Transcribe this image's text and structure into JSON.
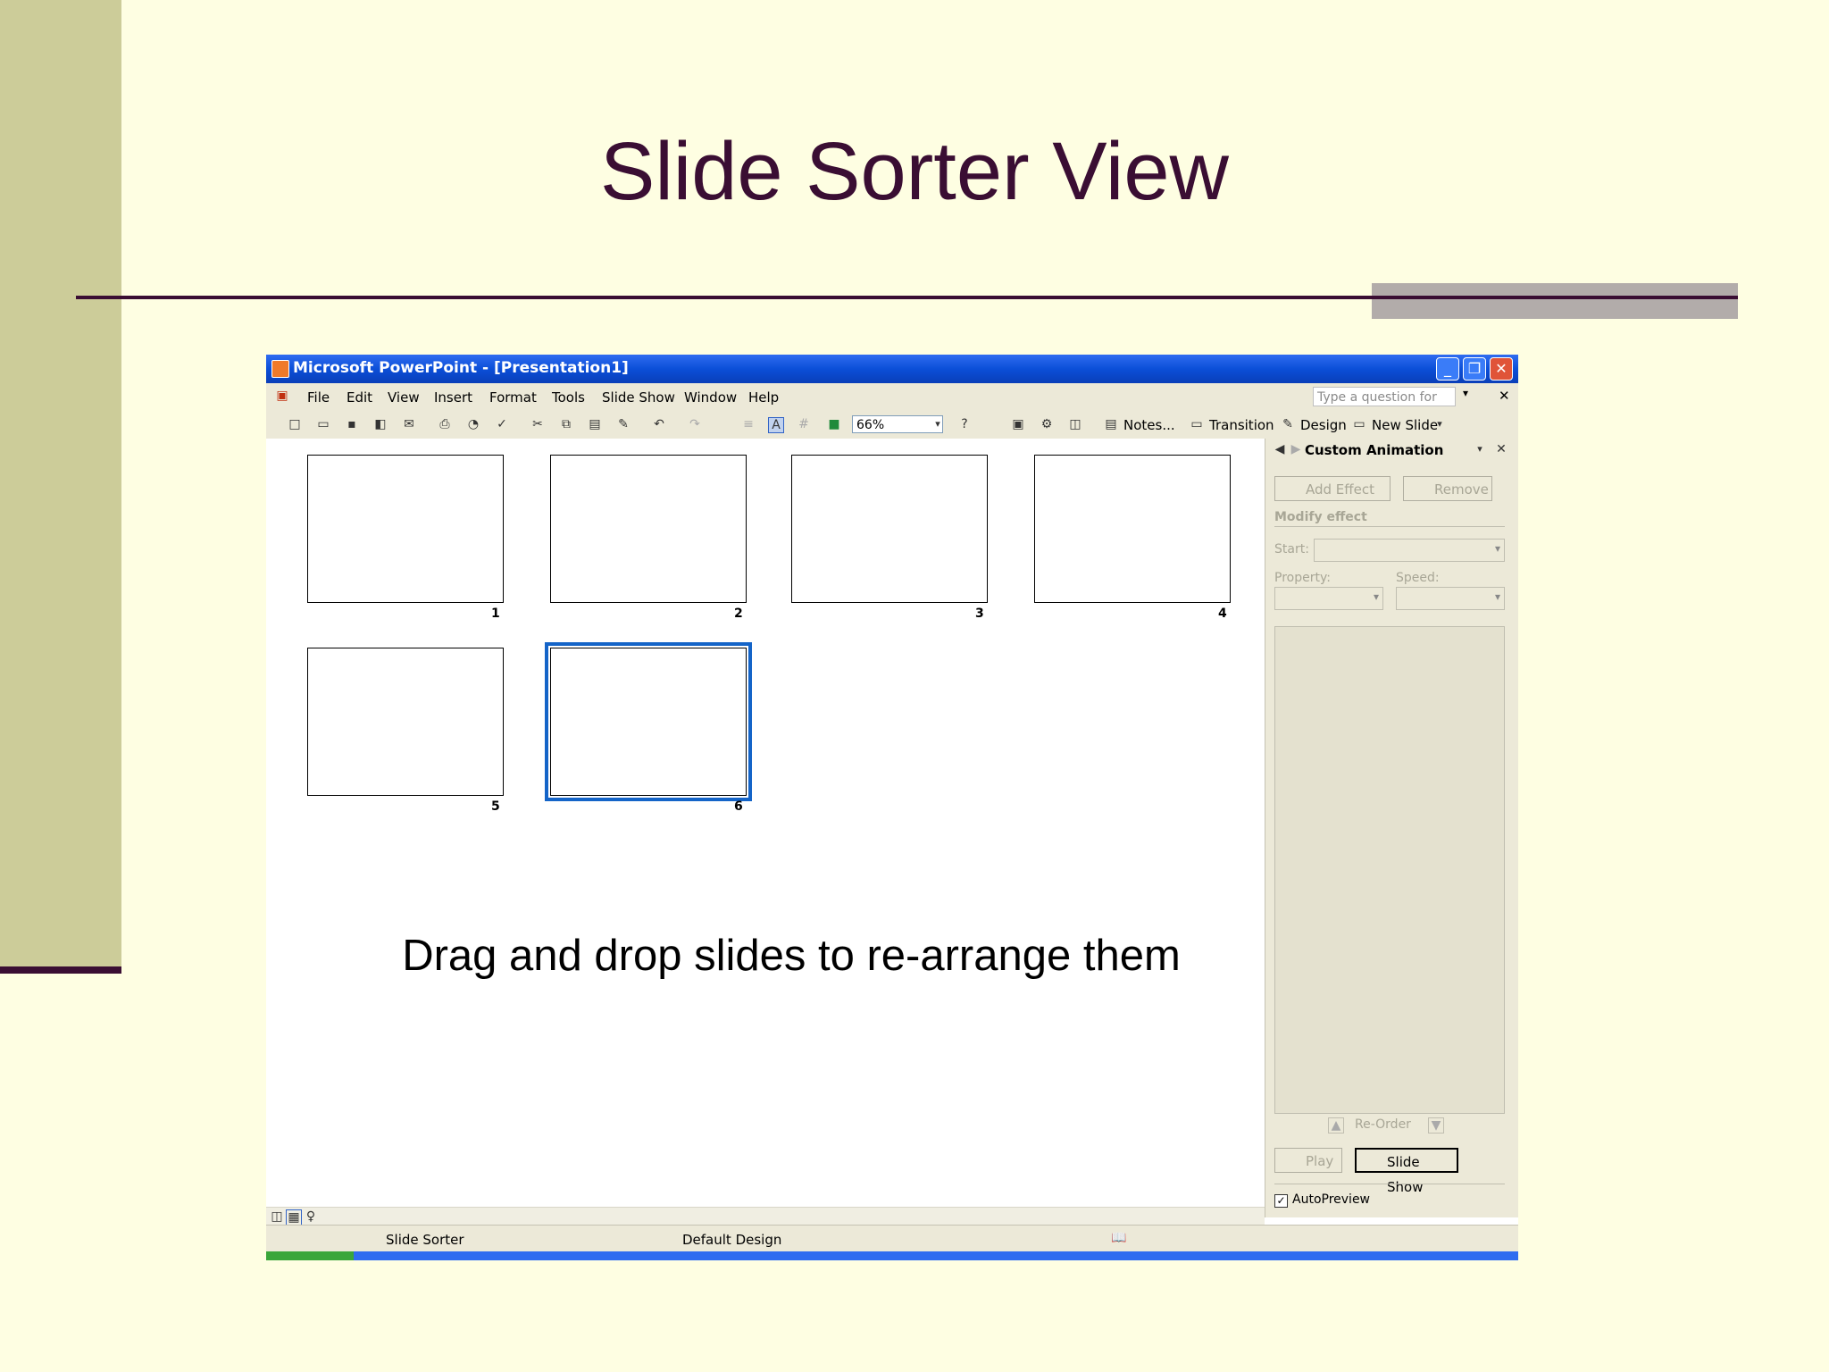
{
  "slide": {
    "title": "Slide Sorter View",
    "caption": "Drag and drop slides to re-arrange them"
  },
  "window": {
    "title": "Microsoft PowerPoint - [Presentation1]",
    "minimize": "_",
    "maximize": "❐",
    "close": "✕"
  },
  "menu": {
    "items": [
      "File",
      "Edit",
      "View",
      "Insert",
      "Format",
      "Tools",
      "Slide Show",
      "Window",
      "Help"
    ],
    "help_placeholder": "Type a question for help",
    "close": "✕"
  },
  "toolbar": {
    "zoom": "66%",
    "notes": "Notes...",
    "transition": "Transition",
    "design": "Design",
    "new_slide": "New Slide"
  },
  "slides": {
    "numbers": [
      "1",
      "2",
      "3",
      "4",
      "5",
      "6"
    ],
    "selected": "6"
  },
  "task_pane": {
    "title": "Custom Animation",
    "add_effect": "Add Effect",
    "remove": "Remove",
    "modify_effect": "Modify effect",
    "start_label": "Start:",
    "property_label": "Property:",
    "speed_label": "Speed:",
    "reorder": "Re-Order",
    "play": "Play",
    "slide_show": "Slide Show",
    "autopreview": "AutoPreview",
    "autopreview_checked": true
  },
  "status": {
    "view": "Slide Sorter",
    "design": "Default Design"
  }
}
